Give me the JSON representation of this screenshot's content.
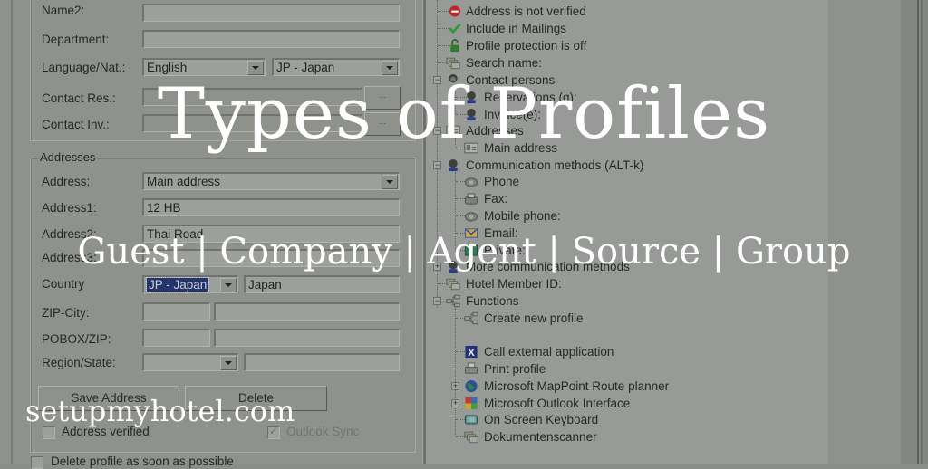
{
  "form": {
    "name2": {
      "label": "Name2:",
      "value": ""
    },
    "department": {
      "label": "Department:",
      "value": ""
    },
    "language_nat": {
      "label": "Language/Nat.:",
      "language": "English",
      "nationality": "JP - Japan"
    },
    "contact_res": {
      "label": "Contact Res.:",
      "value": "",
      "button": "..."
    },
    "contact_inv": {
      "label": "Contact Inv.:",
      "value": "",
      "button": "..."
    }
  },
  "addresses": {
    "group_title": "Addresses",
    "address": {
      "label": "Address:",
      "value": "Main address"
    },
    "address1": {
      "label": "Address1:",
      "value": "12 HB"
    },
    "address2": {
      "label": "Address2:",
      "value": "Thai Road"
    },
    "address3": {
      "label": "Address3:",
      "value": ""
    },
    "country": {
      "label": "Country",
      "code": "JP - Japan",
      "name": "Japan"
    },
    "zip_city": {
      "label": "ZIP-City:",
      "zip": "",
      "city": ""
    },
    "pobox_zip": {
      "label": "POBOX/ZIP:",
      "pobox": "",
      "zip": ""
    },
    "region_state": {
      "label": "Region/State:",
      "code": "",
      "name": ""
    },
    "save_button": "Save Address",
    "delete_button": "Delete",
    "address_verified": {
      "label": "Address verified",
      "checked": false
    },
    "outlook_sync": {
      "label": "Outlook Sync",
      "checked": true,
      "disabled": true
    }
  },
  "delete_profile": {
    "label": "Delete profile as soon as possible",
    "checked": false
  },
  "tree": {
    "items": [
      {
        "label": "Address is not verified",
        "icon": "no-entry-icon"
      },
      {
        "label": "Include in Mailings",
        "icon": "checkmark-icon"
      },
      {
        "label": "Profile protection is off",
        "icon": "unlocked-padlock-icon"
      },
      {
        "label": "Search name:",
        "icon": "cards-icon"
      },
      {
        "label": "Contact persons",
        "icon": "person-icon"
      },
      {
        "label": "Reservations (g):",
        "icon": "person-icon"
      },
      {
        "label": "Invoice(e):",
        "icon": "person-icon"
      },
      {
        "label": "Addresses",
        "icon": "address-card-icon"
      },
      {
        "label": "Main address",
        "icon": "address-card-icon"
      },
      {
        "label": "Communication methods (ALT-k)",
        "icon": "person-icon"
      },
      {
        "label": "Phone",
        "icon": "phone-icon"
      },
      {
        "label": "Fax:",
        "icon": "fax-icon"
      },
      {
        "label": "Mobile phone:",
        "icon": "phone-icon"
      },
      {
        "label": "Email:",
        "icon": "email-icon"
      },
      {
        "label": "Private:",
        "icon": "private-icon"
      },
      {
        "label": "More communication methods",
        "icon": "person-icon"
      },
      {
        "label": "Hotel Member ID:",
        "icon": "cards-icon"
      },
      {
        "label": "Functions",
        "icon": "network-icon"
      },
      {
        "label": "Create new profile",
        "icon": "network-icon"
      },
      {
        "label": "",
        "icon": ""
      },
      {
        "label": "Call external application",
        "icon": "excel-icon"
      },
      {
        "label": "Print profile",
        "icon": "printer-icon"
      },
      {
        "label": "Microsoft MapPoint Route planner",
        "icon": "globe-icon"
      },
      {
        "label": "Microsoft Outlook Interface",
        "icon": "outlook-icon"
      },
      {
        "label": "On Screen Keyboard",
        "icon": "keyboard-icon"
      },
      {
        "label": "Dokumentenscanner",
        "icon": "cards-icon"
      }
    ]
  },
  "overlay": {
    "title": "Types of Profiles",
    "subtitle": "Guest | Company | Agent | Source | Group",
    "site": "setupmyhotel.com"
  },
  "colors": {
    "selection": "#23336b",
    "overlay_text": "#ffffff",
    "dim_background": "#8f928c"
  }
}
